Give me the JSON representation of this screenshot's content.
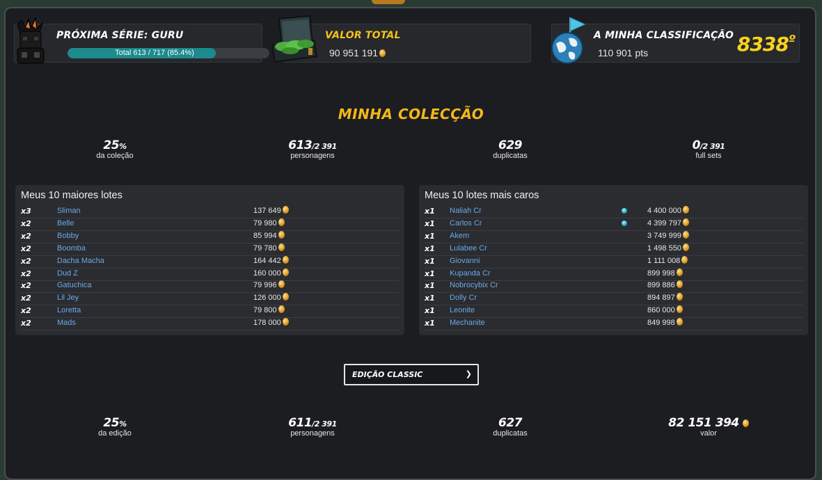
{
  "header": {
    "next_series": {
      "title": "PRÓXIMA SÉRIE: GURU",
      "progress_text": "Total 613 / 717 (85.4%)",
      "progress": 0.854
    },
    "total_value": {
      "title": "VALOR TOTAL",
      "value": "90 951 191"
    },
    "ranking": {
      "title": "A MINHA CLASSIFICAÇÃO",
      "points": "110 901 pts",
      "rank": "8338",
      "rank_suffix": "º"
    }
  },
  "collection": {
    "title": "MINHA COLECÇÃO",
    "stats": [
      {
        "value": "25",
        "unit": "%",
        "label": "da coleção"
      },
      {
        "value": "613",
        "unit": "/2 391",
        "label": "personagens"
      },
      {
        "value": "629",
        "unit": "",
        "label": "duplicatas"
      },
      {
        "value": "0",
        "unit": "/2 391",
        "label": "full sets"
      }
    ]
  },
  "largest_lots": {
    "title": "Meus 10 maiores lotes",
    "rows": [
      {
        "qty": "x3",
        "name": "Sliman",
        "price": "137 649"
      },
      {
        "qty": "x2",
        "name": "Belle",
        "price": "79 980"
      },
      {
        "qty": "x2",
        "name": "Bobby",
        "price": "85 994"
      },
      {
        "qty": "x2",
        "name": "Boomba",
        "price": "79 780"
      },
      {
        "qty": "x2",
        "name": "Dacha Macha",
        "price": "164 442"
      },
      {
        "qty": "x2",
        "name": "Dud Z",
        "price": "160 000"
      },
      {
        "qty": "x2",
        "name": "Gatuchica",
        "price": "79 996"
      },
      {
        "qty": "x2",
        "name": "Lil Jey",
        "price": "126 000"
      },
      {
        "qty": "x2",
        "name": "Loretta",
        "price": "79 800"
      },
      {
        "qty": "x2",
        "name": "Mads",
        "price": "178 000"
      }
    ]
  },
  "expensive_lots": {
    "title": "Meus 10 lotes mais caros",
    "rows": [
      {
        "qty": "x1",
        "name": "Naliah Cr",
        "price": "4 400 000",
        "gem": true
      },
      {
        "qty": "x1",
        "name": "Carlos Cr",
        "price": "4 399 797",
        "gem": true
      },
      {
        "qty": "x1",
        "name": "Akem",
        "price": "3 749 999",
        "gem": false
      },
      {
        "qty": "x1",
        "name": "Lulabee Cr",
        "price": "1 498 550",
        "gem": false
      },
      {
        "qty": "x1",
        "name": "Giovanni",
        "price": "1 111 008",
        "gem": false
      },
      {
        "qty": "x1",
        "name": "Kupanda Cr",
        "price": "899 998",
        "gem": false
      },
      {
        "qty": "x1",
        "name": "Nobrocybix Cr",
        "price": "899 886",
        "gem": false
      },
      {
        "qty": "x1",
        "name": "Dolly Cr",
        "price": "894 897",
        "gem": false
      },
      {
        "qty": "x1",
        "name": "Leonite",
        "price": "860 000",
        "gem": false
      },
      {
        "qty": "x1",
        "name": "Mechanite",
        "price": "849 998",
        "gem": false
      }
    ]
  },
  "edition": {
    "select_label": "EDIÇÃO CLASSIC",
    "stats": [
      {
        "value": "25",
        "unit": "%",
        "label": "da edição"
      },
      {
        "value": "611",
        "unit": "/2 391",
        "label": "personagens"
      },
      {
        "value": "627",
        "unit": "",
        "label": "duplicatas"
      },
      {
        "value": "82 151 394",
        "unit": "",
        "label": "valor"
      }
    ]
  },
  "icons": {
    "character": "dark-character-icon",
    "money": "money-briefcase-icon",
    "globe": "globe-flag-icon",
    "coin": "coin-icon",
    "gem": "gem-icon"
  },
  "colors": {
    "accent_gold": "#f3c21b",
    "link_blue": "#6ea8e8",
    "progress_teal": "#1d8a8d"
  }
}
